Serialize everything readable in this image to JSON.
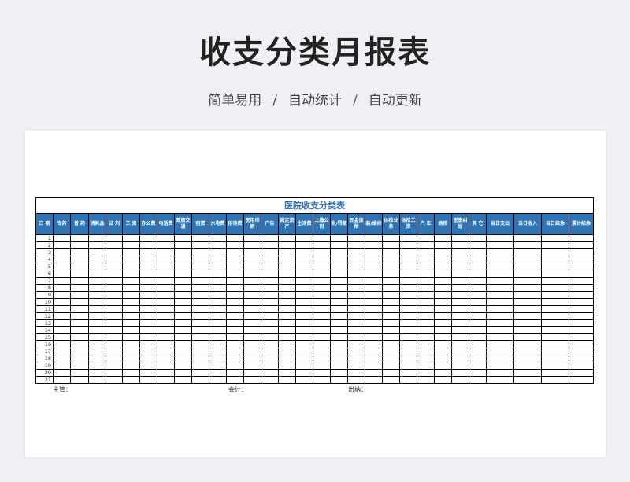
{
  "header": {
    "title": "收支分类月报表",
    "features": [
      "简单易用",
      "自动统计",
      "自动更新"
    ],
    "separator": "/"
  },
  "sheet": {
    "title": "医院收支分类表",
    "columns": [
      "日 期",
      "专药",
      "普 药",
      "消耗品",
      "试 剂",
      "工 资",
      "办公费",
      "电话费",
      "差旅交通",
      "租赁",
      "水电费",
      "招待费",
      "医用印刷",
      "广告",
      "固定资产",
      "生活费",
      "上缴公司",
      "税/罚款",
      "五金保险",
      "装/维修",
      "体检业务",
      "体检工资",
      "汽 车",
      "病检",
      "医患纠纷",
      "其 它",
      "当日支出",
      "当日收入",
      "当日结余",
      "累计结余"
    ],
    "days": [
      "1",
      "2",
      "3",
      "4",
      "5",
      "6",
      "7",
      "8",
      "9",
      "10",
      "11",
      "12",
      "13",
      "14",
      "15",
      "16",
      "17",
      "18",
      "19",
      "20",
      "21"
    ],
    "footer": {
      "supervisor": "主管：",
      "accountant": "会计：",
      "cashier": "出纳："
    }
  },
  "colors": {
    "header_fill": "#2e74b5",
    "sheet_title": "#2e74b5",
    "background": "#eef0f4"
  }
}
